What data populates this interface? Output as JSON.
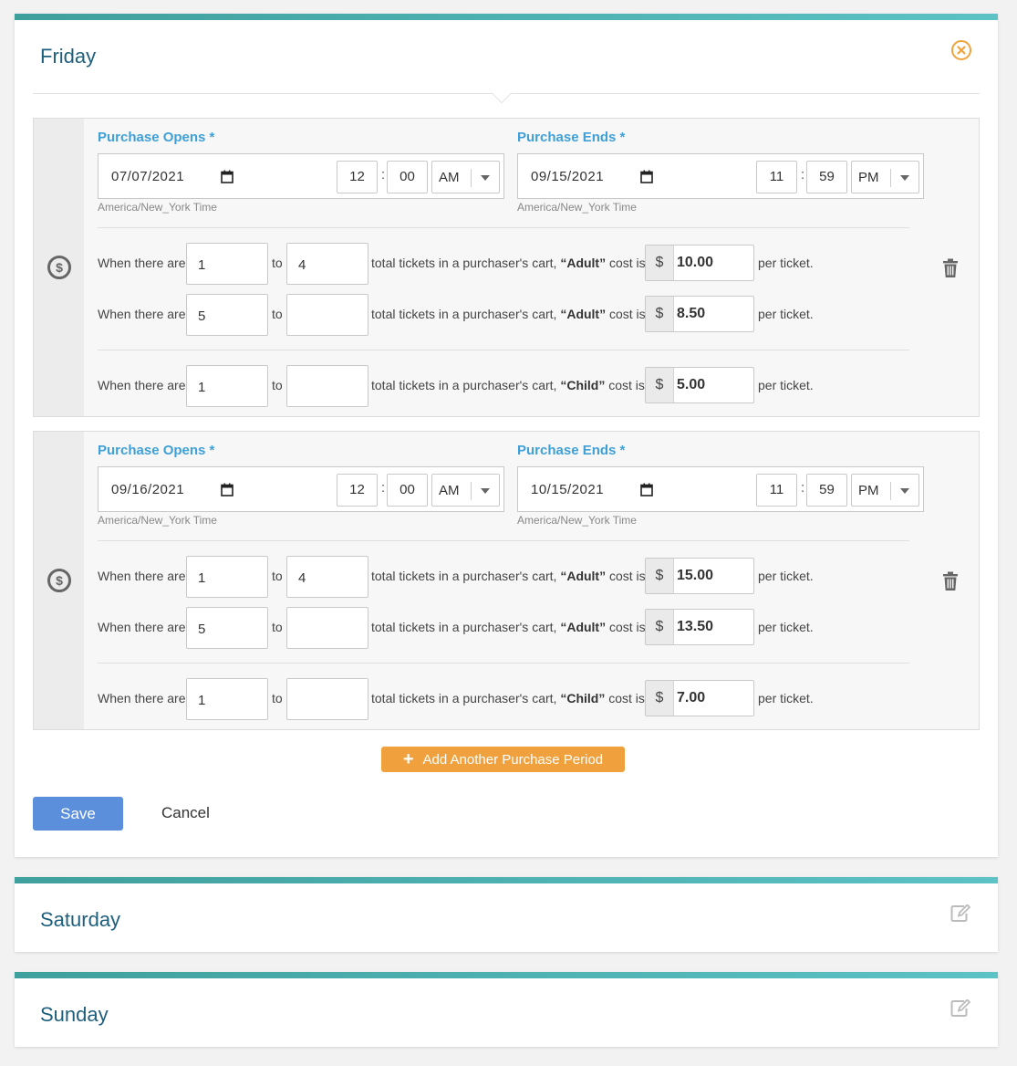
{
  "days": {
    "friday": {
      "title": "Friday"
    },
    "saturday": {
      "title": "Saturday"
    },
    "sunday": {
      "title": "Sunday"
    }
  },
  "colors": {
    "accent": "#f0a03c",
    "title": "#1f5f7e",
    "label": "#3fa0d8",
    "save": "#5b8fdc",
    "topbar": "#4fb3b5"
  },
  "labels": {
    "opens": "Purchase Opens *",
    "ends": "Purchase Ends *",
    "timezone": "America/New_York Time",
    "when": "When there are",
    "to": "to",
    "cart": "total tickets in a purchaser's cart,",
    "cost_is": "cost is",
    "per_ticket": "per ticket.",
    "currency": "$",
    "colon": ":"
  },
  "periods": [
    {
      "opens": {
        "date": "07/07/2021",
        "hour": "12",
        "minute": "00",
        "ampm": "AM"
      },
      "ends": {
        "date": "09/15/2021",
        "hour": "11",
        "minute": "59",
        "ampm": "PM"
      },
      "rules": [
        {
          "from": "1",
          "to": "4",
          "type": "“Adult”",
          "price": "10.00"
        },
        {
          "from": "5",
          "to": "",
          "type": "“Adult”",
          "price": "8.50"
        },
        {
          "from": "1",
          "to": "",
          "type": "“Child”",
          "price": "5.00"
        }
      ]
    },
    {
      "opens": {
        "date": "09/16/2021",
        "hour": "12",
        "minute": "00",
        "ampm": "AM"
      },
      "ends": {
        "date": "10/15/2021",
        "hour": "11",
        "minute": "59",
        "ampm": "PM"
      },
      "rules": [
        {
          "from": "1",
          "to": "4",
          "type": "“Adult”",
          "price": "15.00"
        },
        {
          "from": "5",
          "to": "",
          "type": "“Adult”",
          "price": "13.50"
        },
        {
          "from": "1",
          "to": "",
          "type": "“Child”",
          "price": "7.00"
        }
      ]
    }
  ],
  "buttons": {
    "add_period": "Add Another Purchase Period",
    "save": "Save",
    "cancel": "Cancel"
  },
  "icons": {
    "close": "close-circle-icon",
    "edit": "edit-icon",
    "dollar": "dollar-circle-icon",
    "trash": "trash-icon",
    "calendar": "calendar-icon",
    "plus": "plus-icon"
  }
}
